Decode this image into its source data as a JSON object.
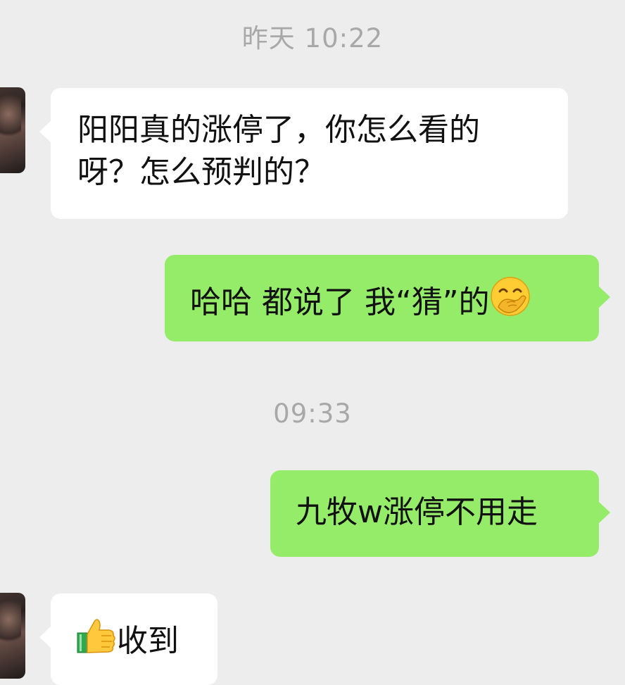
{
  "messages": [
    {
      "kind": "timestamp",
      "text": "昨天 10:22"
    },
    {
      "kind": "incoming",
      "text": "阳阳真的涨停了，你怎么看的\n呀？怎么预判的？"
    },
    {
      "kind": "outgoing",
      "text_before_emoji": "哈哈 都说了 我“猜”的",
      "emoji": "hand-over-mouth-emoji"
    },
    {
      "kind": "timestamp",
      "text": "09:33"
    },
    {
      "kind": "outgoing",
      "text": "九牧w涨停不用走"
    },
    {
      "kind": "incoming",
      "emoji": "thumbs-up-emoji",
      "text_after_emoji": "收到"
    }
  ],
  "colors": {
    "background": "#ededed",
    "incoming_bubble": "#ffffff",
    "outgoing_bubble": "#95ec69",
    "timestamp_text": "#a8a8a8",
    "message_text": "#111111"
  }
}
